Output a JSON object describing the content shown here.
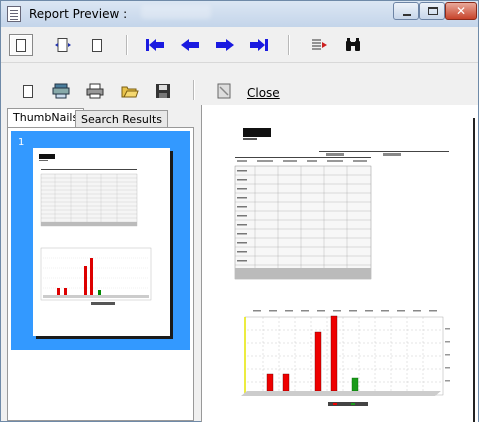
{
  "window": {
    "title": "Report Preview :"
  },
  "toolbar2": {
    "close_label": "Close"
  },
  "tabs": [
    {
      "label": "ThumbNails"
    },
    {
      "label": "Search Results"
    }
  ],
  "thumbnail": {
    "page_number": "1"
  }
}
